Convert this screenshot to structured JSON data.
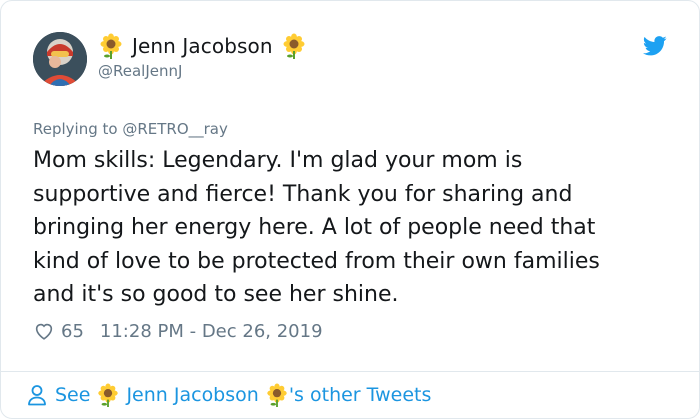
{
  "tweet": {
    "author_display_name": "Jenn Jacobson",
    "author_handle": "@RealJennJ",
    "reply_context": "Replying to @RETRO__ray",
    "text": "Mom skills: Legendary. I'm glad your mom is\nsupportive and fierce! Thank you for sharing and\nbringing her energy here. A lot of people need that\nkind of love to be protected from their own families\nand it's so good to see her shine.",
    "like_count": "65",
    "timestamp": "11:28 PM - Dec 26, 2019"
  },
  "footer": {
    "see_label": "See",
    "author_name": "Jenn Jacobson",
    "suffix": "'s other Tweets"
  },
  "icons": {
    "brand": "twitter-bird-icon",
    "like": "heart-icon",
    "profile": "person-icon",
    "emoji": "sunflower-icon"
  },
  "colors": {
    "brand_blue": "#1da1f2",
    "link_blue": "#1b95e0",
    "muted_gray": "#657786",
    "text_dark": "#14171a"
  }
}
